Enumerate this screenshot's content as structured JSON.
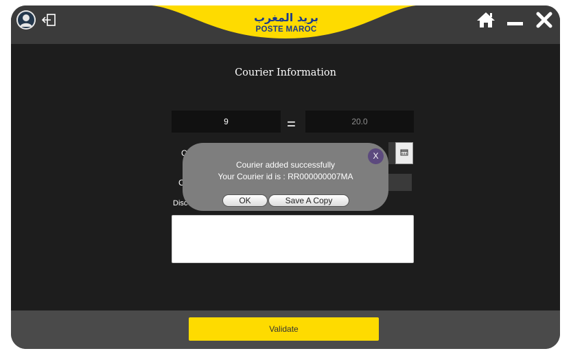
{
  "header": {
    "logo_arabic": "بريد المغرب",
    "logo_latin": "POSTE MAROC",
    "icons": [
      "user-avatar-icon",
      "logout-icon",
      "home-icon",
      "minimize-icon",
      "close-icon"
    ],
    "brand_yellow": "#fedb00",
    "brand_blue": "#1b3b8c"
  },
  "main": {
    "title": "Courier Information",
    "weight_value": "9",
    "equals_sign": "=",
    "price_value": "20.0",
    "label_row2_partial": "C",
    "label_row3_partial": "C",
    "description_label_partial": "Disc",
    "calendar_icon": "calendar-icon"
  },
  "dialog": {
    "message_line1": "Courier added successfully",
    "message_line2": "Your Courier id is : RR000000007MA",
    "close_label": "X",
    "ok_label": "OK",
    "copy_label": "Save A Copy"
  },
  "footer": {
    "validate_label": "Validate"
  }
}
